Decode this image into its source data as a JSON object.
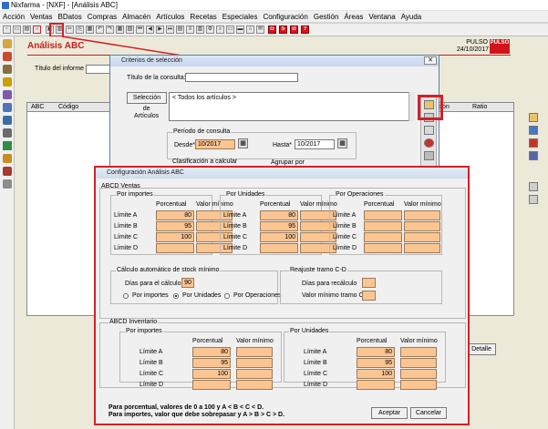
{
  "window": {
    "title": "Nixfarma - [NXF] - [Análisis ABC]"
  },
  "menu": [
    {
      "label": "Acción",
      "enabled": true
    },
    {
      "label": "Ventas",
      "enabled": true
    },
    {
      "label": "BDatos",
      "enabled": true
    },
    {
      "label": "Compras",
      "enabled": true
    },
    {
      "label": "Almacén",
      "enabled": true
    },
    {
      "label": "Artículos",
      "enabled": true
    },
    {
      "label": "Recetas",
      "enabled": true
    },
    {
      "label": "Especiales",
      "enabled": true
    },
    {
      "label": "Configuración",
      "enabled": true
    },
    {
      "label": "Gestión",
      "enabled": true
    },
    {
      "label": "Áreas",
      "enabled": true
    },
    {
      "label": "Ventana",
      "enabled": true
    },
    {
      "label": "Ayuda",
      "enabled": true
    }
  ],
  "toolbar": {
    "letters": [
      "G",
      "S",
      "D",
      "?"
    ]
  },
  "page": {
    "title": "Análisis ABC",
    "brand": "PULSO",
    "date": "24/10/2017",
    "logo": "PULSO",
    "report_title_label": "Título del informe"
  },
  "table": {
    "headers": [
      "ABC",
      "Código",
      "ción",
      "Ratio"
    ]
  },
  "bottom_button": "Detalle",
  "criterios": {
    "title": "Criterios de selección",
    "consulta_label": "Título de la consulta:",
    "seleccion_button": "Selección",
    "articulos_label": "de\nArtículos",
    "articulos_value": "< Todos los artículos >",
    "periodo_label": "Período de consulta",
    "desde_label": "Desde*",
    "desde_value": "10/2017",
    "hasta_label": "Hasta*",
    "hasta_value": "10/2017",
    "clasificacion_label": "Clasificación a calcular",
    "agrupar_label": "Agrupar por"
  },
  "config": {
    "title": "Configuración Análisis ABC",
    "ventas_section": "ABCD Ventas",
    "col_porcentual": "Porcentual",
    "col_minimo": "Valor mínimo",
    "groups": [
      {
        "title": "Por importes",
        "rows": [
          {
            "label": "Límite A",
            "pct": "80",
            "min": ""
          },
          {
            "label": "Límite B",
            "pct": "95",
            "min": ""
          },
          {
            "label": "Límite C",
            "pct": "100",
            "min": ""
          },
          {
            "label": "Límite D",
            "pct": "",
            "min": ""
          }
        ]
      },
      {
        "title": "Por Unidades",
        "rows": [
          {
            "label": "Límite A",
            "pct": "80",
            "min": ""
          },
          {
            "label": "Límite B",
            "pct": "95",
            "min": ""
          },
          {
            "label": "Límite C",
            "pct": "100",
            "min": ""
          },
          {
            "label": "Límite D",
            "pct": "",
            "min": ""
          }
        ]
      },
      {
        "title": "Por Operaciones",
        "rows": [
          {
            "label": "Límite A",
            "pct": "",
            "min": ""
          },
          {
            "label": "Límite B",
            "pct": "",
            "min": ""
          },
          {
            "label": "Límite C",
            "pct": "",
            "min": ""
          },
          {
            "label": "Límite D",
            "pct": "",
            "min": ""
          }
        ]
      }
    ],
    "stock_title": "Cálculo automático de stock mínimo",
    "dias_label": "Días para el cálculo",
    "dias_value": "90",
    "radio_importes": "Por importes",
    "radio_unidades": "Por Unidades",
    "radio_operaciones": "Por Operaciones",
    "selected_radio": "Por Unidades",
    "reajuste_title": "Reajuste tramo C-D",
    "recalculo_label": "Días para recálculo",
    "minimo_c_label": "Valor mínimo tramo C",
    "inventario_section": "ABCD Inventario",
    "inv_groups": [
      {
        "title": "Por importes",
        "rows": [
          {
            "label": "Límite A",
            "pct": "80",
            "min": ""
          },
          {
            "label": "Límite B",
            "pct": "95",
            "min": ""
          },
          {
            "label": "Límite C",
            "pct": "100",
            "min": ""
          },
          {
            "label": "Límite D",
            "pct": "",
            "min": ""
          }
        ]
      },
      {
        "title": "Por Unidades",
        "rows": [
          {
            "label": "Límite A",
            "pct": "80",
            "min": ""
          },
          {
            "label": "Límite B",
            "pct": "95",
            "min": ""
          },
          {
            "label": "Límite C",
            "pct": "100",
            "min": ""
          },
          {
            "label": "Límite D",
            "pct": "",
            "min": ""
          }
        ]
      }
    ],
    "note1": "Para porcentual, valores de 0 a 100 y A < B < C < D.",
    "note2": "Para importes, valor que debe sobrepasar y A > B > C > D.",
    "accept": "Aceptar",
    "cancel": "Cancelar"
  },
  "colors": {
    "accent_red": "#d42027",
    "input_orange": "#fbc592",
    "title_red": "#c71d1d"
  }
}
